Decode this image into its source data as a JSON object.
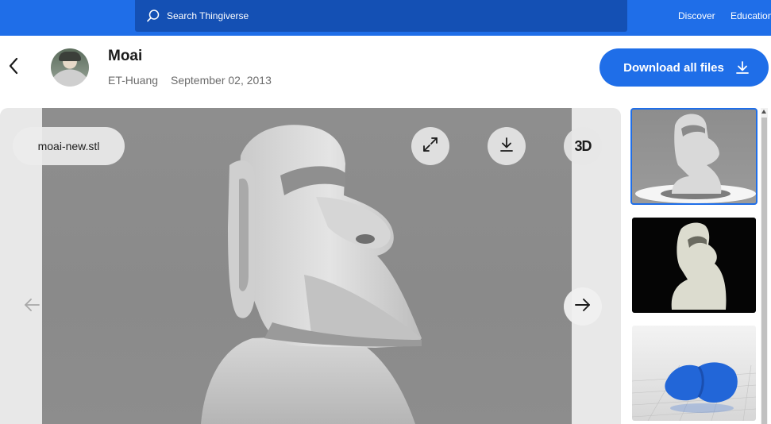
{
  "topbar": {
    "search_placeholder": "Search Thingiverse",
    "nav": {
      "discover": "Discover",
      "education": "Education"
    }
  },
  "thing": {
    "title": "Moai",
    "author": "ET-Huang",
    "date": "September 02, 2013",
    "download_all_label": "Download all files"
  },
  "viewer": {
    "file_name": "moai-new.stl",
    "three_d_label": "3D"
  },
  "thumbnails": [
    {
      "selected": true
    },
    {
      "selected": false
    },
    {
      "selected": false
    }
  ],
  "icons": {
    "search": "search-icon",
    "back": "chevron-left-icon",
    "download": "download-icon",
    "expand": "expand-icon",
    "prev": "arrow-left-icon",
    "next": "arrow-right-icon"
  },
  "colors": {
    "brand_blue": "#1f6ee8",
    "search_bg": "#1450b4",
    "viewer_bg": "#e8e8e8"
  }
}
